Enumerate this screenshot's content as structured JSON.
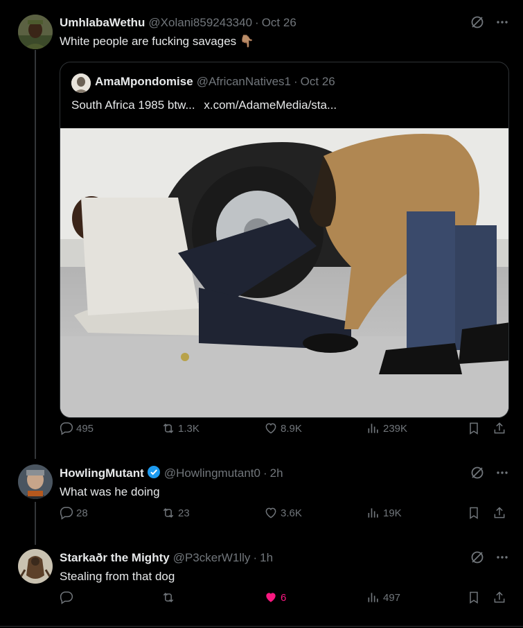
{
  "posts": [
    {
      "name": "UmhlabaWethu",
      "handle": "@Xolani859243340",
      "time": "Oct 26",
      "text": "White people are fucking savages 👇🏽",
      "quote": {
        "name": "AmaMpondomise",
        "handle": "@AfricanNatives1",
        "time": "Oct 26",
        "text": "South Africa 1985 btw...",
        "link": "x.com/AdameMedia/sta..."
      },
      "replies": "495",
      "reposts": "1.3K",
      "likes": "8.9K",
      "views": "239K"
    },
    {
      "name": "HowlingMutant",
      "handle": "@Howlingmutant0",
      "time": "2h",
      "text": "What was he doing",
      "replies": "28",
      "reposts": "23",
      "likes": "3.6K",
      "views": "19K"
    },
    {
      "name": "Starkaðr the Mighty",
      "handle": "@P3ckerW1lly",
      "time": "1h",
      "text": "Stealing from that dog",
      "replies": "",
      "reposts": "",
      "likes": "6",
      "views": "497"
    }
  ],
  "colors": {
    "background": "#000000",
    "text": "#e7e9ea",
    "muted": "#71767b",
    "liked": "#f91880",
    "verified": "#1d9bf0"
  },
  "icons": [
    "grok-icon",
    "more-icon",
    "reply-icon",
    "repost-icon",
    "like-icon",
    "views-icon",
    "bookmark-icon",
    "share-icon",
    "verified-badge-icon"
  ]
}
